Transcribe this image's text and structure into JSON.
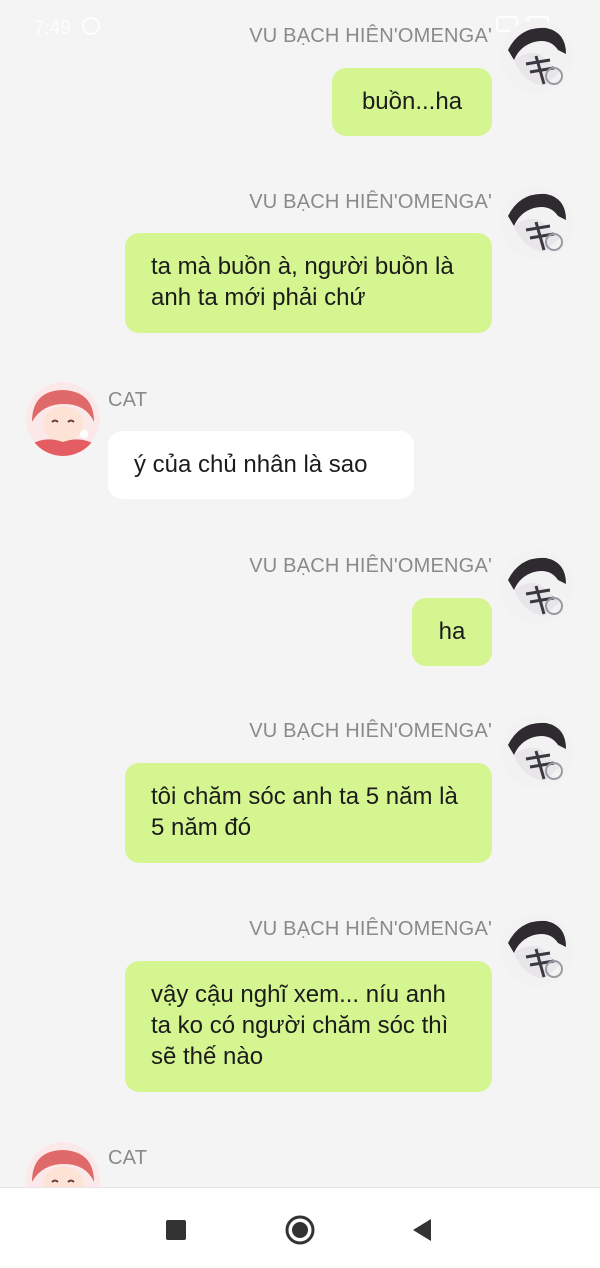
{
  "status_bar": {
    "time": "7:49"
  },
  "users": {
    "me": {
      "name": "VU BẠCH HIÊN'OMENGA'"
    },
    "cat": {
      "name": "CAT"
    }
  },
  "messages": [
    {
      "sender": "VU BẠCH HIÊN'OMENGA'",
      "text": "buồn...ha"
    },
    {
      "sender": "VU BẠCH HIÊN'OMENGA'",
      "text": "ta mà buồn à, người buồn là anh ta mới phải chứ"
    },
    {
      "sender": "CAT",
      "text": "ý của chủ nhân là sao"
    },
    {
      "sender": "VU BẠCH HIÊN'OMENGA'",
      "text": "ha"
    },
    {
      "sender": "VU BẠCH HIÊN'OMENGA'",
      "text": "tôi chăm sóc anh ta 5 năm là 5 năm đó"
    },
    {
      "sender": "VU BẠCH HIÊN'OMENGA'",
      "text": "vậy cậu nghĩ xem... níu anh ta ko có người chăm sóc thì sẽ thế nào"
    },
    {
      "sender": "CAT",
      "text": ""
    }
  ],
  "colors": {
    "background": "#f4f4f4",
    "outgoing_bubble": "#d4f58f",
    "incoming_bubble": "#ffffff",
    "sender_name": "#8a8a8a",
    "message_text": "#1b1b1b",
    "nav_icon": "#333333"
  },
  "nav_bar": {
    "recent_icon": "square-icon",
    "home_icon": "circle-home-icon",
    "back_icon": "triangle-back-icon"
  }
}
